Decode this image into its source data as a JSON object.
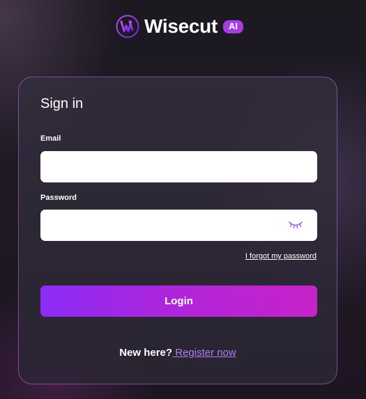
{
  "brand": {
    "name": "Wisecut",
    "badge": "AI",
    "accent_color": "#a43ee0"
  },
  "signin": {
    "title": "Sign in",
    "email_label": "Email",
    "email_value": "",
    "password_label": "Password",
    "password_value": "",
    "toggle_icon": "eye-closed-icon",
    "forgot_link": "I forgot my password",
    "login_label": "Login",
    "register_prefix": "New here?",
    "register_link": " Register now"
  }
}
